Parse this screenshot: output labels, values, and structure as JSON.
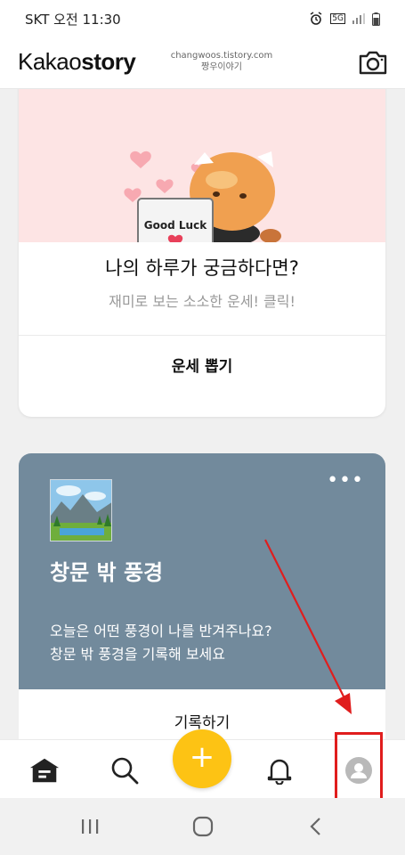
{
  "status_bar": {
    "carrier_time": "SKT  오전 11:30",
    "network": "5G"
  },
  "header": {
    "logo_light": "Kakao",
    "logo_bold": "story",
    "watermark_line1": "changwoos.tistory.com",
    "watermark_line2": "짱우이야기"
  },
  "fortune_card": {
    "image_caption": "Good Luck",
    "title": "나의 하루가 궁금하다면?",
    "subtitle": "재미로 보는 소소한 운세! 클릭!",
    "action_label": "운세 뽑기"
  },
  "scenery_card": {
    "title": "창문 밖 풍경",
    "description_line1": "오늘은 어떤 풍경이 나를 반겨주나요?",
    "description_line2": "창문 밖 풍경을 기록해 보세요",
    "more_label": "•••",
    "action_label": "기록하기",
    "background_color": "#728a9c"
  },
  "bottom_nav": {
    "fab_label": "+",
    "fab_color": "#fdc314",
    "items": [
      "home-icon",
      "search-icon",
      "bell-icon",
      "profile-icon"
    ]
  },
  "annotation": {
    "color": "#e01d1d"
  }
}
